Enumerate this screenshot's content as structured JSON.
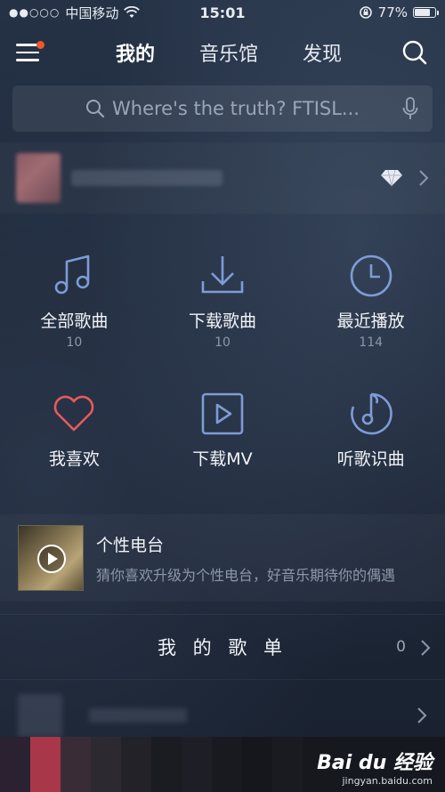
{
  "status_bar": {
    "signal": "●●○○○",
    "carrier": "中国移动",
    "time": "15:01",
    "battery": "77%",
    "battery_level": 0.77
  },
  "nav": {
    "tabs": [
      {
        "label": "我的",
        "active": true
      },
      {
        "label": "音乐馆",
        "active": false
      },
      {
        "label": "发现",
        "active": false
      }
    ]
  },
  "search": {
    "placeholder": "Where's the truth? FTISL..."
  },
  "grid": [
    {
      "label": "全部歌曲",
      "count": "10",
      "icon": "music-note-icon"
    },
    {
      "label": "下载歌曲",
      "count": "10",
      "icon": "download-icon"
    },
    {
      "label": "最近播放",
      "count": "114",
      "icon": "clock-icon"
    },
    {
      "label": "我喜欢",
      "count": "",
      "icon": "heart-icon"
    },
    {
      "label": "下载MV",
      "count": "",
      "icon": "video-play-icon"
    },
    {
      "label": "听歌识曲",
      "count": "",
      "icon": "music-recognize-icon"
    }
  ],
  "radio": {
    "title": "个性电台",
    "desc": "猜你喜欢升级为个性电台，好音乐期待你的偶遇"
  },
  "playlists": {
    "title": "我 的 歌 单",
    "count": "0"
  },
  "watermark": {
    "brand": "Bai du 经验",
    "url": "jingyan.baidu.com"
  },
  "colors": {
    "accent_red": "#e85a5a",
    "accent_blue": "#7e9cd6",
    "badge": "#f2572b"
  }
}
